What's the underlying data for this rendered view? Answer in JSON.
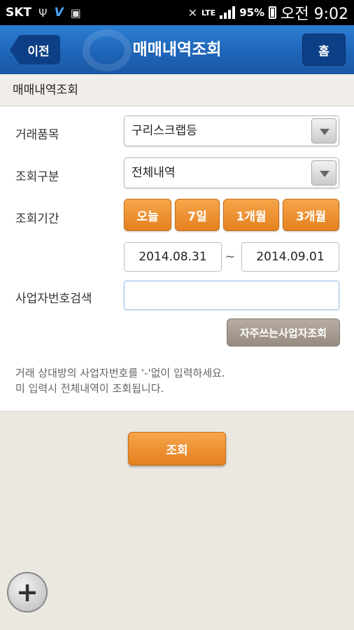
{
  "status_bar": {
    "carrier": "SKT",
    "network": "LTE",
    "battery": "95%",
    "time": "오전 9:02",
    "icons": [
      "usb-icon",
      "v-app-icon",
      "screenshot-icon",
      "mute-icon",
      "signal-icon",
      "battery-icon"
    ]
  },
  "header": {
    "back_label": "이전",
    "title": "매매내역조회",
    "home_label": "홈"
  },
  "section": {
    "title": "매매내역조회"
  },
  "form": {
    "item_label": "거래품목",
    "item_value": "구리스크랩등",
    "type_label": "조회구분",
    "type_value": "전체내역",
    "period_label": "조회기간",
    "period_buttons": [
      "오늘",
      "7일",
      "1개월",
      "3개월"
    ],
    "date_from": "2014.08.31",
    "date_sep": "~",
    "date_to": "2014.09.01",
    "biz_label": "사업자번호검색",
    "biz_value": "",
    "fav_button": "자주쓰는사업자조회",
    "notice_line1": "거래 상대방의  사업자번호를 '-'없이 입력하세요.",
    "notice_line2": "미 입력시 전체내역이 조회됩니다."
  },
  "search_button": "조회",
  "fab_label": "+",
  "colors": {
    "header_blue": "#1e63b6",
    "orange": "#e5801f",
    "gray_button": "#978b80"
  }
}
